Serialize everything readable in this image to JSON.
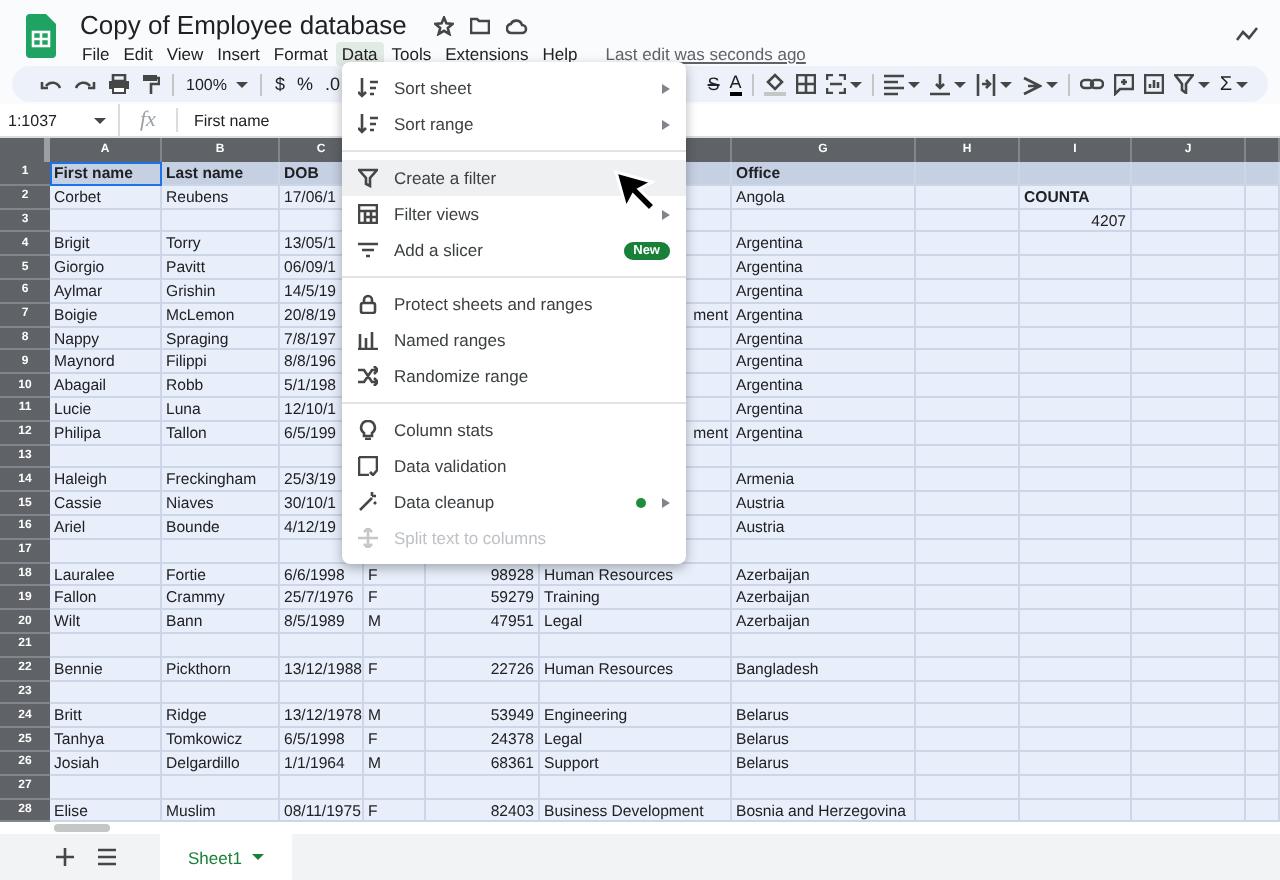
{
  "app": {
    "title": "Copy of Employee database",
    "last_edit": "Last edit was seconds ago",
    "menus": [
      {
        "label": "File",
        "selected": false
      },
      {
        "label": "Edit",
        "selected": false
      },
      {
        "label": "View",
        "selected": false
      },
      {
        "label": "Insert",
        "selected": false
      },
      {
        "label": "Format",
        "selected": false
      },
      {
        "label": "Data",
        "selected": true
      },
      {
        "label": "Tools",
        "selected": false
      },
      {
        "label": "Extensions",
        "selected": false
      },
      {
        "label": "Help",
        "selected": false
      }
    ]
  },
  "toolbar": {
    "zoom": "100%",
    "left_buttons": [
      {
        "label": "$"
      },
      {
        "label": "%"
      },
      {
        "label": ".0"
      }
    ],
    "right_buttons": [
      {
        "label": "S",
        "kind": "strikethrough"
      },
      {
        "label": "A",
        "kind": "text-color"
      }
    ],
    "end_button": {
      "label": "Σ"
    }
  },
  "formula_bar": {
    "name_box": "1:1037",
    "fx": "fx",
    "value": "First name"
  },
  "sheet": {
    "columns": [
      "A",
      "B",
      "C",
      null,
      null,
      null,
      "G",
      "H",
      "I",
      "J"
    ],
    "header_row": {
      "number": "1",
      "cells": [
        {
          "text": "First name",
          "active": true
        },
        {
          "text": "Last name",
          "active": false
        },
        {
          "text": "DOB",
          "active": false
        },
        null,
        null,
        null,
        {
          "text": "Office",
          "active": false
        },
        null,
        null,
        null
      ]
    },
    "rows": [
      {
        "number": "2",
        "cells": [
          "Corbet",
          "Reubens",
          "17/06/1",
          null,
          null,
          null,
          "Angola",
          null,
          {
            "text": "COUNTA",
            "kind": "bold"
          },
          null
        ]
      },
      {
        "number": "3",
        "cells": [
          null,
          null,
          null,
          null,
          null,
          null,
          null,
          null,
          {
            "text": "4207",
            "kind": "number"
          },
          null
        ]
      },
      {
        "number": "4",
        "cells": [
          "Brigit",
          "Torry",
          "13/05/1",
          null,
          null,
          null,
          "Argentina",
          null,
          null,
          null
        ]
      },
      {
        "number": "5",
        "cells": [
          "Giorgio",
          "Pavitt",
          "06/09/1",
          null,
          null,
          null,
          "Argentina",
          null,
          null,
          null
        ]
      },
      {
        "number": "6",
        "cells": [
          "Aylmar",
          "Grishin",
          "14/5/19",
          null,
          null,
          null,
          "Argentina",
          null,
          null,
          null
        ]
      },
      {
        "number": "7",
        "cells": [
          "Boigie",
          "McLemon",
          "20/8/19",
          null,
          null,
          {
            "text": "ment",
            "kind": "cut_left"
          },
          "Argentina",
          null,
          null,
          null
        ]
      },
      {
        "number": "8",
        "cells": [
          "Nappy",
          "Spraging",
          "7/8/197",
          null,
          null,
          null,
          "Argentina",
          null,
          null,
          null
        ]
      },
      {
        "number": "9",
        "cells": [
          "Maynord",
          "Filippi",
          "8/8/196",
          null,
          null,
          null,
          "Argentina",
          null,
          null,
          null
        ]
      },
      {
        "number": "10",
        "cells": [
          "Abagail",
          "Robb",
          "5/1/198",
          null,
          null,
          null,
          "Argentina",
          null,
          null,
          null
        ]
      },
      {
        "number": "11",
        "cells": [
          "Lucie",
          "Luna",
          "12/10/1",
          null,
          null,
          null,
          "Argentina",
          null,
          null,
          null
        ]
      },
      {
        "number": "12",
        "cells": [
          "Philipa",
          "Tallon",
          "6/5/199",
          null,
          null,
          {
            "text": "ment",
            "kind": "cut_left"
          },
          "Argentina",
          null,
          null,
          null
        ]
      },
      {
        "number": "13",
        "cells": [
          null,
          null,
          null,
          null,
          null,
          null,
          null,
          null,
          null,
          null
        ]
      },
      {
        "number": "14",
        "cells": [
          "Haleigh",
          "Freckingham",
          "25/3/19",
          null,
          null,
          null,
          "Armenia",
          null,
          null,
          null
        ]
      },
      {
        "number": "15",
        "cells": [
          "Cassie",
          "Niaves",
          "30/10/1",
          null,
          null,
          null,
          "Austria",
          null,
          null,
          null
        ]
      },
      {
        "number": "16",
        "cells": [
          "Ariel",
          "Bounde",
          "4/12/19",
          null,
          null,
          null,
          "Austria",
          null,
          null,
          null
        ]
      },
      {
        "number": "17",
        "cells": [
          null,
          null,
          null,
          null,
          null,
          null,
          null,
          null,
          null,
          null
        ]
      },
      {
        "number": "18",
        "cells": [
          "Lauralee",
          "Fortie",
          "6/6/1998",
          "F",
          {
            "text": "98928",
            "kind": "number"
          },
          "Human Resources",
          "Azerbaijan",
          null,
          null,
          null
        ]
      },
      {
        "number": "19",
        "cells": [
          "Fallon",
          "Crammy",
          "25/7/1976",
          "F",
          {
            "text": "59279",
            "kind": "number"
          },
          "Training",
          "Azerbaijan",
          null,
          null,
          null
        ]
      },
      {
        "number": "20",
        "cells": [
          "Wilt",
          "Bann",
          "8/5/1989",
          "M",
          {
            "text": "47951",
            "kind": "number"
          },
          "Legal",
          "Azerbaijan",
          null,
          null,
          null
        ]
      },
      {
        "number": "21",
        "cells": [
          null,
          null,
          null,
          null,
          null,
          null,
          null,
          null,
          null,
          null
        ]
      },
      {
        "number": "22",
        "cells": [
          "Bennie",
          "Pickthorn",
          "13/12/1988",
          "F",
          {
            "text": "22726",
            "kind": "number"
          },
          "Human Resources",
          "Bangladesh",
          null,
          null,
          null
        ]
      },
      {
        "number": "23",
        "cells": [
          null,
          null,
          null,
          null,
          null,
          null,
          null,
          null,
          null,
          null
        ]
      },
      {
        "number": "24",
        "cells": [
          "Britt",
          "Ridge",
          "13/12/1978",
          "M",
          {
            "text": "53949",
            "kind": "number"
          },
          "Engineering",
          "Belarus",
          null,
          null,
          null
        ]
      },
      {
        "number": "25",
        "cells": [
          "Tanhya",
          "Tomkowicz",
          "6/5/1998",
          "F",
          {
            "text": "24378",
            "kind": "number"
          },
          "Legal",
          "Belarus",
          null,
          null,
          null
        ]
      },
      {
        "number": "26",
        "cells": [
          "Josiah",
          "Delgardillo",
          "1/1/1964",
          "M",
          {
            "text": "68361",
            "kind": "number"
          },
          "Support",
          "Belarus",
          null,
          null,
          null
        ]
      },
      {
        "number": "27",
        "cells": [
          null,
          null,
          null,
          null,
          null,
          null,
          null,
          null,
          null,
          null
        ]
      },
      {
        "number": "28",
        "cells": [
          "Elise",
          "Muslim",
          "08/11/1975",
          "F",
          {
            "text": "82403",
            "kind": "number"
          },
          "Business Development",
          "Bosnia and Herzegovina",
          null,
          null,
          null
        ]
      }
    ]
  },
  "data_menu": {
    "groups": [
      [
        {
          "label": "Sort sheet",
          "submenu": true,
          "hovered": false,
          "disabled": false
        },
        {
          "label": "Sort range",
          "submenu": true,
          "hovered": false,
          "disabled": false
        }
      ],
      [
        {
          "label": "Create a filter",
          "submenu": false,
          "hovered": true,
          "disabled": false
        },
        {
          "label": "Filter views",
          "submenu": true,
          "hovered": false,
          "disabled": false
        },
        {
          "label": "Add a slicer",
          "submenu": false,
          "hovered": false,
          "disabled": false,
          "badge": "New"
        }
      ],
      [
        {
          "label": "Protect sheets and ranges",
          "submenu": false,
          "hovered": false,
          "disabled": false
        },
        {
          "label": "Named ranges",
          "submenu": false,
          "hovered": false,
          "disabled": false
        },
        {
          "label": "Randomize range",
          "submenu": false,
          "hovered": false,
          "disabled": false
        }
      ],
      [
        {
          "label": "Column stats",
          "submenu": false,
          "hovered": false,
          "disabled": false
        },
        {
          "label": "Data validation",
          "submenu": false,
          "hovered": false,
          "disabled": false
        },
        {
          "label": "Data cleanup",
          "submenu": true,
          "hovered": false,
          "disabled": false,
          "dot": true
        },
        {
          "label": "Split text to columns",
          "submenu": false,
          "hovered": false,
          "disabled": true
        }
      ]
    ]
  },
  "sheet_tabs": [
    {
      "label": "Sheet1",
      "selected": true
    }
  ]
}
